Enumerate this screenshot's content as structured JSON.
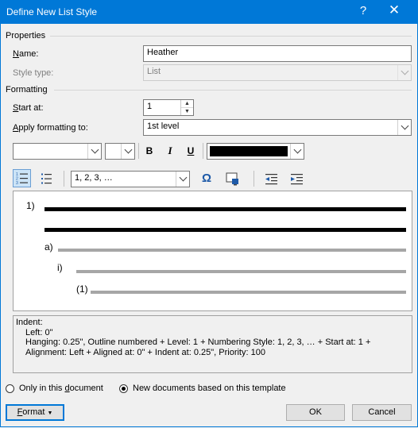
{
  "window": {
    "title": "Define New List Style",
    "help_label": "?",
    "close_label": "✕"
  },
  "properties": {
    "section_label": "Properties",
    "name_label": "Name:",
    "name_value": "Heather",
    "style_type_label": "Style type:",
    "style_type_value": "List"
  },
  "formatting": {
    "section_label": "Formatting",
    "start_at_label": "Start at:",
    "start_at_value": "1",
    "apply_to_label": "Apply formatting to:",
    "apply_to_value": "1st level",
    "font_name_value": "",
    "font_size_value": "",
    "bold_label": "B",
    "italic_label": "I",
    "underline_label": "U",
    "font_color": "#000000",
    "numbering_style_value": "1, 2, 3, …",
    "symbol_label": "Ω"
  },
  "preview": {
    "level1": "1)",
    "level2": "a)",
    "level3": "i)",
    "level4": "(1)"
  },
  "description": {
    "line1": "Indent:",
    "line2": "Left:  0\"",
    "line3": "Hanging:  0.25\", Outline numbered + Level: 1 + Numbering Style: 1, 2, 3, … + Start at: 1 +",
    "line4": "Alignment: Left + Aligned at:  0\" + Indent at:  0.25\", Priority: 100"
  },
  "options": {
    "only_this_document": "Only in this document",
    "new_documents": "New documents based on this template",
    "selected": "new_documents"
  },
  "buttons": {
    "format": "Format",
    "ok": "OK",
    "cancel": "Cancel"
  },
  "colors": {
    "accent": "#0078d7"
  }
}
